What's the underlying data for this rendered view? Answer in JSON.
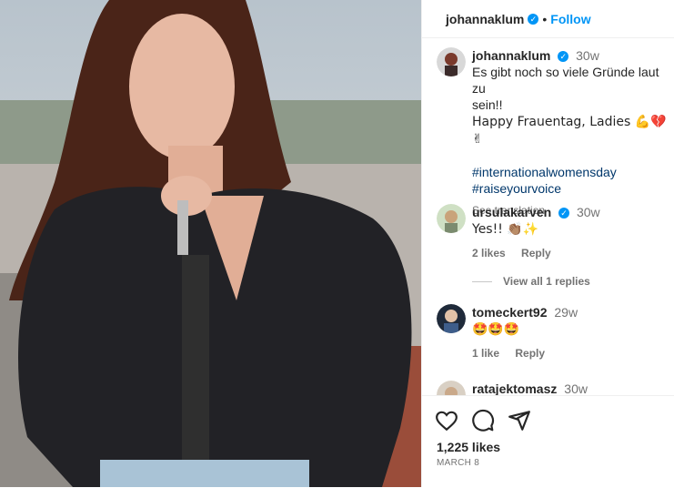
{
  "post": {
    "username": "johannaklum",
    "follow_label": "Follow",
    "separator": "•"
  },
  "caption": {
    "username": "johannaklum",
    "time": "30w",
    "text_line1": "Es gibt noch so viele Gründe laut zu",
    "text_line2": "sein!!",
    "text_line3": "Happy Frauentag, Ladies 💪💔✌",
    "hashtag1": "#internationalwomensday",
    "hashtag2": "#raiseyourvoice",
    "see_translation": "See translation"
  },
  "comments": [
    {
      "username": "ursulakarven",
      "verified": true,
      "time": "30w",
      "text": "Yes!! 👏🏽✨",
      "likes": "2 likes",
      "reply": "Reply"
    },
    {
      "username": "tomeckert92",
      "time": "29w",
      "text": "🤩🤩🤩",
      "likes": "1 like",
      "reply": "Reply"
    },
    {
      "username": "ratajektomasz",
      "time": "30w"
    }
  ],
  "view_replies": "View all 1 replies",
  "footer": {
    "likes": "1,225 likes",
    "date": "MARCH 8"
  },
  "icons": [
    "heart-icon",
    "comment-icon",
    "share-icon",
    "verified-badge-icon"
  ],
  "colors": {
    "link": "#0095f6",
    "hashtag": "#00376b",
    "muted": "#737373"
  }
}
